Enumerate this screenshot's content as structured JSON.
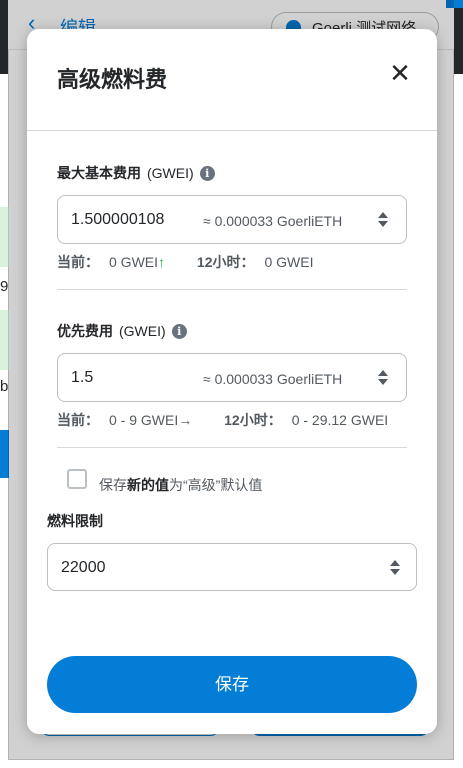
{
  "background": {
    "header_title": "编辑",
    "network_label": "Goerli 测试网络",
    "edge_char_1": "9",
    "edge_char_2": "b"
  },
  "modal": {
    "title": "高级燃料费",
    "close_glyph": "✕",
    "max_base_fee": {
      "label": "最大基本费用",
      "unit": "(GWEI)",
      "value": "1.500000108",
      "conversion": "≈ 0.000033 GoerliETH",
      "current_label": "当前：",
      "current_value": "0 GWEI",
      "current_trend": "↑",
      "h12_label": "12小时：",
      "h12_value": "0 GWEI"
    },
    "priority_fee": {
      "label": "优先费用",
      "unit": "(GWEI)",
      "value": "1.5",
      "conversion": "≈ 0.000033 GoerliETH",
      "current_label": "当前：",
      "current_value": "0 - 9 GWEI",
      "current_trend": "→",
      "h12_label": "12小时：",
      "h12_value": "0 - 29.12 GWEI"
    },
    "save_default": {
      "prefix": "保存",
      "bold": "新的值",
      "suffix": "为“高级”默认值",
      "checked": false
    },
    "gas_limit": {
      "label": "燃料限制",
      "value": "22000"
    },
    "save_button": "保存"
  },
  "colors": {
    "primary": "#037dd6",
    "trend_up": "#28a745",
    "text": "#24272a",
    "muted": "#535a61",
    "border": "#bbc0c5"
  }
}
